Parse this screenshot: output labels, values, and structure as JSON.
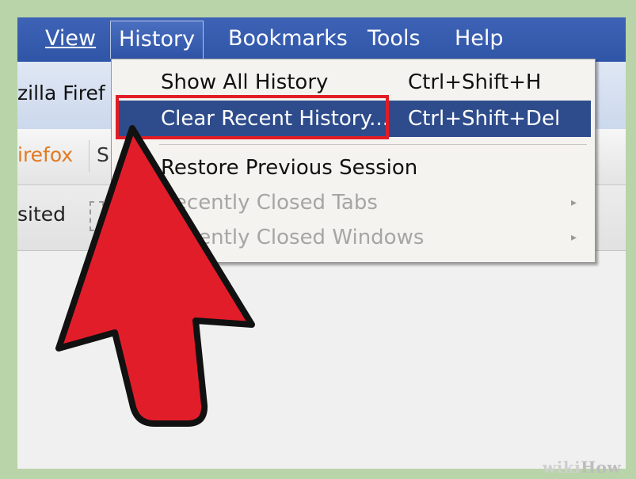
{
  "menubar": {
    "items": [
      {
        "label": "View"
      },
      {
        "label": "History"
      },
      {
        "label": "Bookmarks"
      },
      {
        "label": "Tools"
      },
      {
        "label": "Help"
      }
    ]
  },
  "window": {
    "title_partial": "zilla Firef",
    "tab_partial": "irefox",
    "tab_next_partial": "S",
    "bookmark_partial": "sited"
  },
  "history_menu": {
    "items": [
      {
        "label": "Show All History",
        "shortcut": "Ctrl+Shift+H",
        "enabled": true
      },
      {
        "label": "Clear Recent History...",
        "shortcut": "Ctrl+Shift+Del",
        "enabled": true,
        "highlighted": true
      },
      {
        "label": "Restore Previous Session",
        "shortcut": "",
        "enabled": true
      },
      {
        "label": "Recently Closed Tabs",
        "shortcut": "",
        "enabled": false,
        "submenu": true
      },
      {
        "label": "Recently Closed Windows",
        "shortcut": "",
        "enabled": false,
        "submenu": true
      }
    ],
    "submenu_arrow": "▸"
  },
  "annotation": {
    "arrow_color": "#e21d2a",
    "box_color": "#e11c25"
  },
  "watermark": {
    "part1": "wiki",
    "part2": "How"
  },
  "colors": {
    "menubar": "#2f55a7",
    "highlight": "#2e4c8c",
    "border": "#b9d4a8"
  }
}
